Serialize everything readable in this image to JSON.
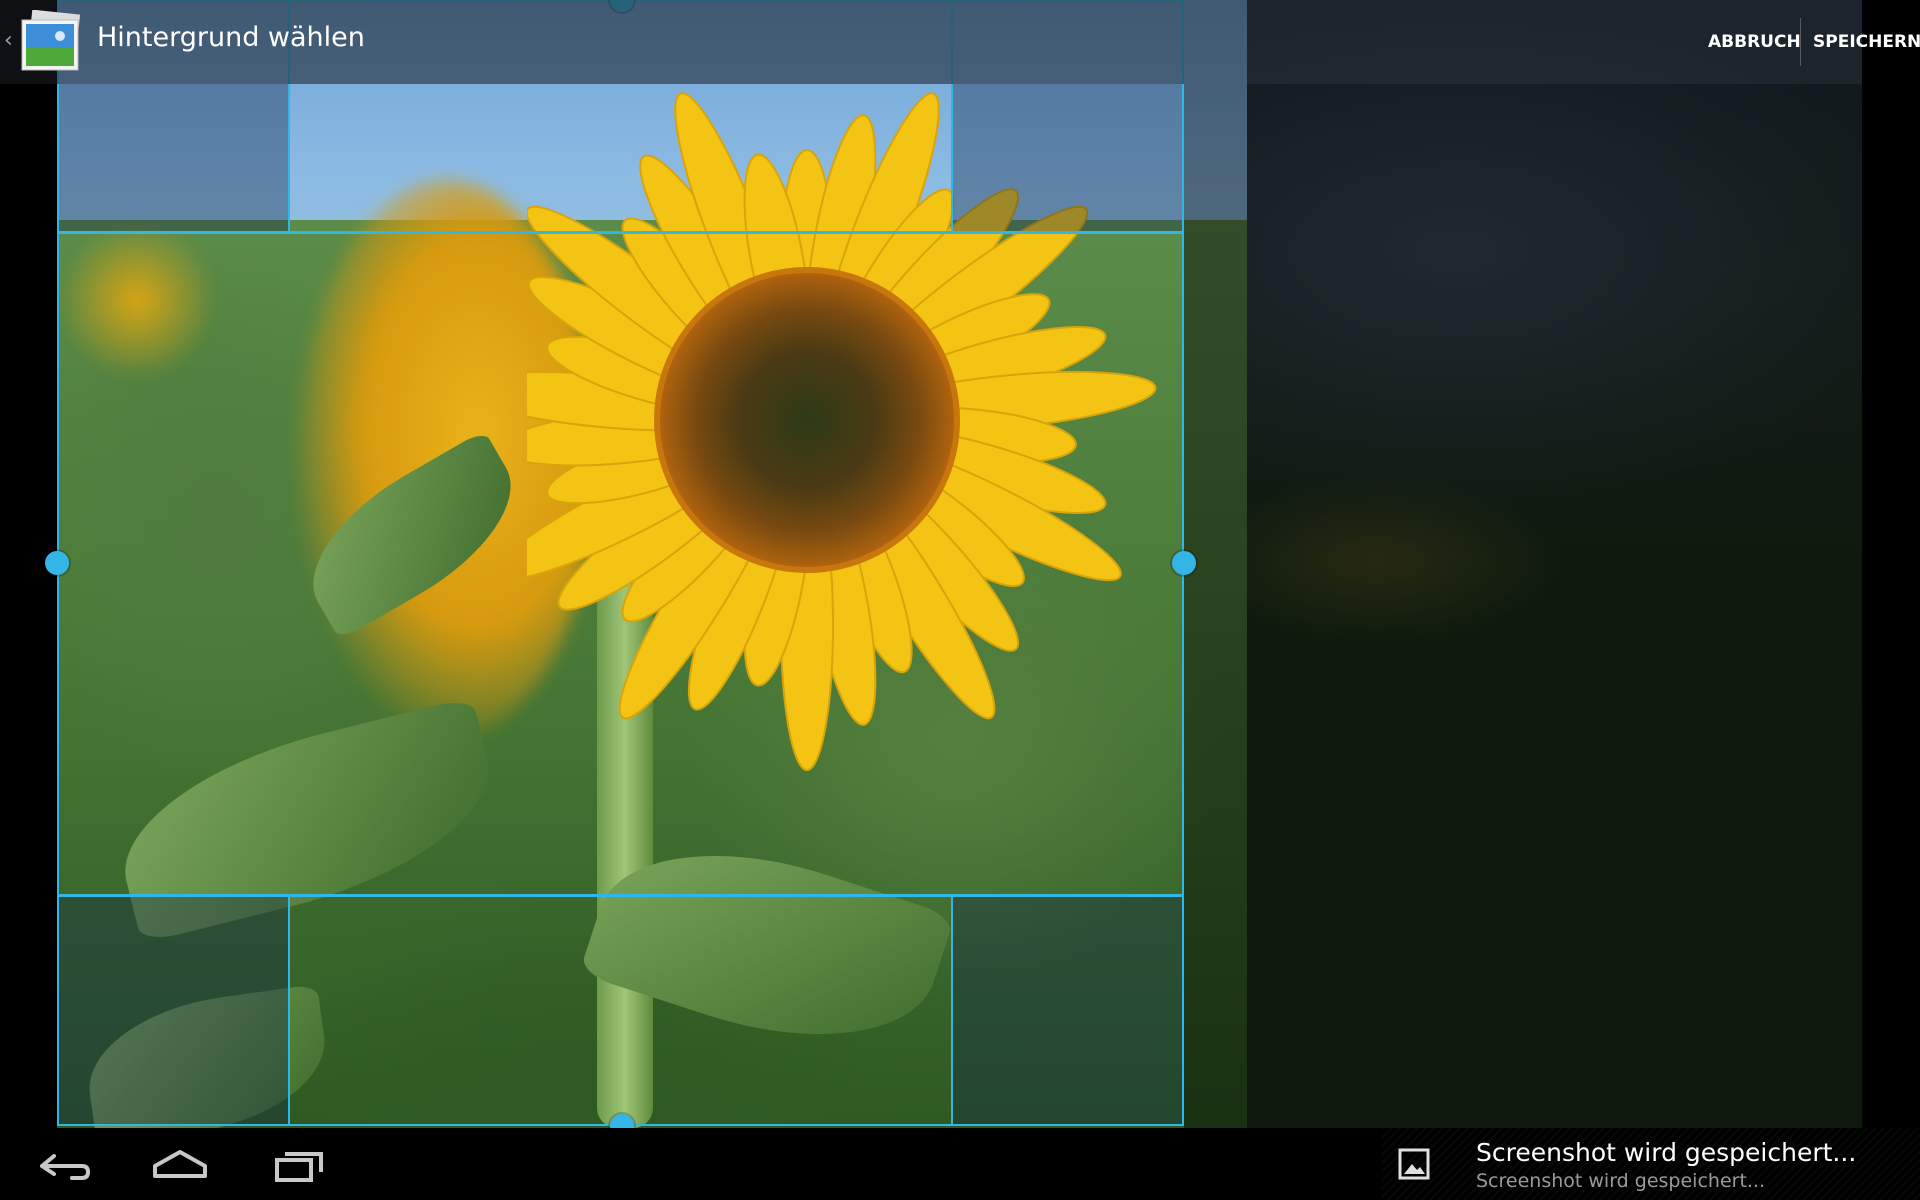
{
  "actionbar": {
    "title": "Hintergrund wählen",
    "cancel_label": "ABBRUCH",
    "save_label": "SPEICHERN",
    "app_icon": "gallery-photo-icon"
  },
  "navbar": {
    "buttons": [
      "back-icon",
      "home-icon",
      "recent-apps-icon"
    ]
  },
  "notification": {
    "icon": "image-icon",
    "title": "Screenshot wird gespeichert...",
    "subtitle": "Screenshot wird gespeichert..."
  },
  "colors": {
    "accent": "#33b5e5",
    "actionbar": "#1a1e24",
    "navbar": "#000000"
  }
}
